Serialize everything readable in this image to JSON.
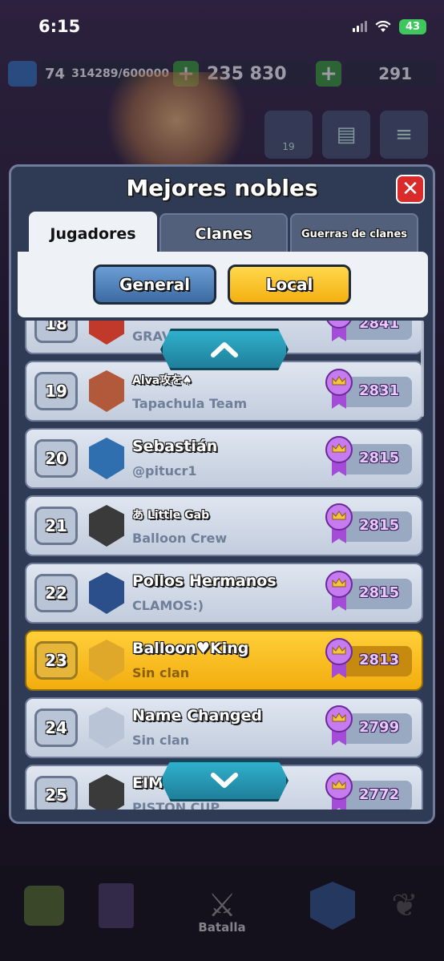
{
  "status_bar": {
    "time": "6:15",
    "battery": "43"
  },
  "hud": {
    "level": "74",
    "xp": "314289/600000",
    "gold": "235 830",
    "gems": "291"
  },
  "side": {
    "friends_count": "19"
  },
  "panel": {
    "title": "Mejores nobles",
    "tabs": [
      "Jugadores",
      "Clanes",
      "Guerras de clanes"
    ],
    "filters": {
      "general": "General",
      "local": "Local"
    }
  },
  "rows": [
    {
      "rank": "18",
      "name": "",
      "clan": "GRAV",
      "trophies": "2841",
      "badge_color": "#c0392b"
    },
    {
      "rank": "19",
      "name": "Alva攻を♠",
      "clan": "Tapachula Team",
      "trophies": "2831",
      "badge_color": "#b3593b"
    },
    {
      "rank": "20",
      "name": "Sebastián",
      "clan": "@pitucr1",
      "trophies": "2815",
      "badge_color": "#2f6fb0"
    },
    {
      "rank": "21",
      "name": "あ Little Gab",
      "clan": "Balloon Crew",
      "trophies": "2815",
      "badge_color": "#3a3a3a"
    },
    {
      "rank": "22",
      "name": "Pollos Hermanos",
      "clan": "CLAMOS:)",
      "trophies": "2815",
      "badge_color": "#2a4f8a"
    },
    {
      "rank": "23",
      "name": "Balloon♥King",
      "clan": "Sin clan",
      "trophies": "2813",
      "badge_color": "#e0a82a"
    },
    {
      "rank": "24",
      "name": "Name Changed",
      "clan": "Sin clan",
      "trophies": "2799",
      "badge_color": "#b9c4d6"
    },
    {
      "rank": "25",
      "name": "EIM",
      "clan": "PISTON CUP",
      "trophies": "2772",
      "badge_color": "#3a3a3a"
    }
  ],
  "bottom_nav": {
    "battle_label": "Batalla"
  }
}
